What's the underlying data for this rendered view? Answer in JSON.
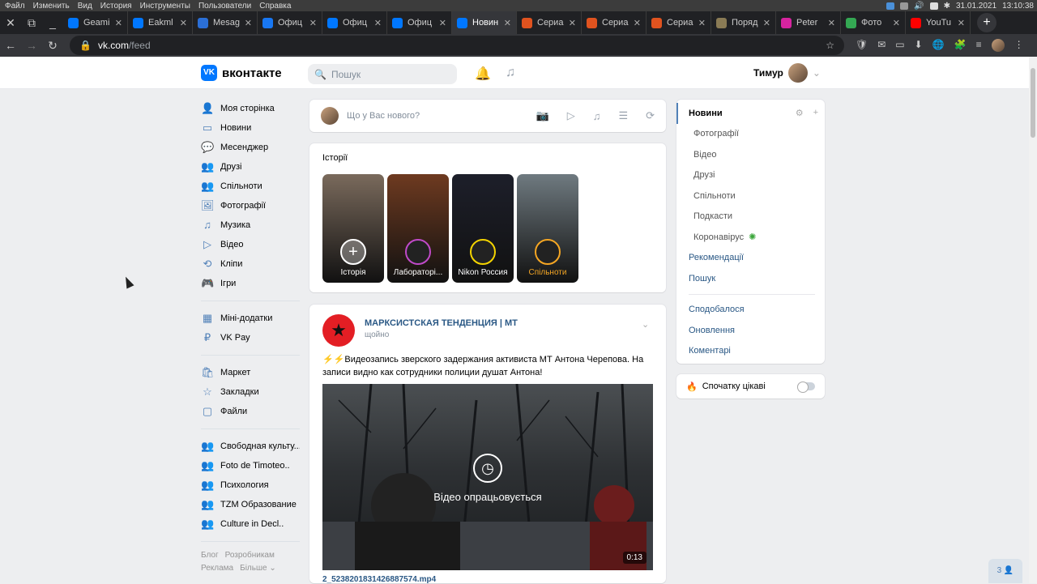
{
  "os_bar": {
    "menu": [
      "Файл",
      "Изменить",
      "Вид",
      "История",
      "Инструменты",
      "Пользователи",
      "Справка"
    ],
    "date": "31.01.2021",
    "time": "13:10:38"
  },
  "tabs": [
    {
      "label": "Geami",
      "color": "#0077ff"
    },
    {
      "label": "Eakml",
      "color": "#0077ff"
    },
    {
      "label": "Mesag",
      "color": "#2b6fd6"
    },
    {
      "label": "Офиц",
      "color": "#1877f2"
    },
    {
      "label": "Офиц",
      "color": "#0077ff"
    },
    {
      "label": "Офиц",
      "color": "#0077ff"
    },
    {
      "label": "Новин",
      "color": "#0077ff",
      "active": true
    },
    {
      "label": "Сериа",
      "color": "#e0531f"
    },
    {
      "label": "Сериа",
      "color": "#e0531f"
    },
    {
      "label": "Сериа",
      "color": "#e0531f"
    },
    {
      "label": "Поряд",
      "color": "#8a7b55"
    },
    {
      "label": "Peter",
      "color": "#d6249f"
    },
    {
      "label": "Фото",
      "color": "#34a853"
    },
    {
      "label": "YouTu",
      "color": "#ff0000"
    }
  ],
  "browser": {
    "url_host": "vk.com",
    "url_path": "/feed"
  },
  "vk": {
    "logo_text": "вконтакте",
    "search_placeholder": "Пошук",
    "user_name": "Тимур"
  },
  "left_nav": {
    "group1": [
      "Моя сторінка",
      "Новини",
      "Месенджер",
      "Друзі",
      "Спільноти",
      "Фотографії",
      "Музика",
      "Відео",
      "Кліпи",
      "Ігри"
    ],
    "group2": [
      "Міні-додатки",
      "VK Pay"
    ],
    "group3": [
      "Маркет",
      "Закладки",
      "Файли"
    ],
    "group4": [
      "Свободная культу...",
      "Foto de Timoteo..",
      "Психология",
      "TZM Образование",
      "Culture in Decl.."
    ],
    "footer": [
      "Блог",
      "Розробникам",
      "Реклама",
      "Більше ⌄"
    ]
  },
  "compose": {
    "placeholder": "Що у Вас нового?"
  },
  "stories": {
    "title": "Історії",
    "items": [
      {
        "label": "Історія",
        "bg": "#7a6a5c",
        "ring": "#ffffff"
      },
      {
        "label": "Лабораторі...",
        "bg": "#6e3a20",
        "ring": "#c04ac9"
      },
      {
        "label": "Nikon Россия",
        "bg": "#1d1f2a",
        "ring": "#f5d400"
      },
      {
        "label": "Спільноти",
        "bg": "#6f7a80",
        "ring": "#f5a623"
      }
    ]
  },
  "post": {
    "author": "МАРКСИСТСКАЯ ТЕНДЕНЦИЯ | МТ",
    "time": "щойно",
    "text": "⚡⚡Видеозапись зверского задержания активиста МТ Антона Черепова. На записи видно как сотрудники полиции душат Антона!",
    "video_status": "Відео опрацьовується",
    "duration": "0:13",
    "file_name": "2_5238201831426887574.mp4"
  },
  "right_nav": {
    "active": "Новини",
    "subs": [
      "Фотографії",
      "Відео",
      "Друзі",
      "Спільноти",
      "Подкасти",
      "Коронавірус"
    ],
    "links": [
      "Рекомендації",
      "Пошук"
    ],
    "links2": [
      "Сподобалося",
      "Оновлення",
      "Коментарі"
    ]
  },
  "toggle": {
    "label": "Спочатку цікаві"
  },
  "chat": {
    "count": "3"
  }
}
